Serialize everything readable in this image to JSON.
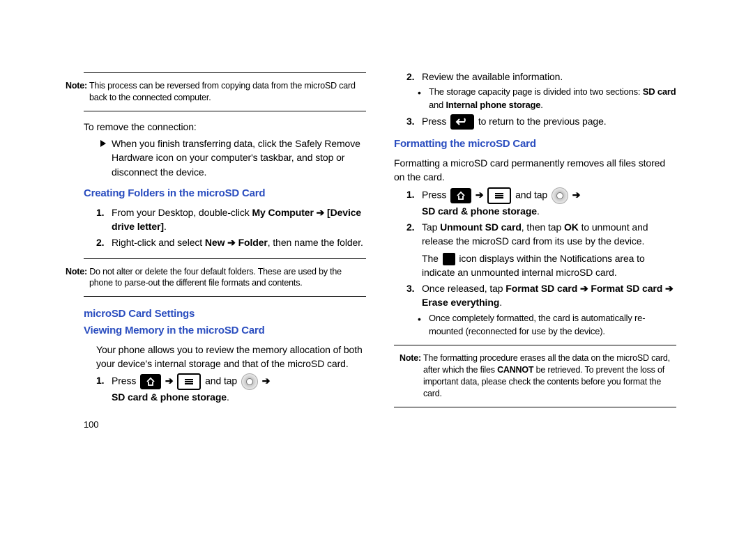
{
  "left": {
    "note1": {
      "label": "Note:",
      "text": " This process can be reversed from copying data from the microSD card back to the connected computer."
    },
    "removeIntro": "To remove the connection:",
    "removeBullet": "When you finish transferring data, click the Safely Remove Hardware icon on your computer's taskbar, and stop or disconnect the device.",
    "h1": "Creating Folders in the microSD Card",
    "step1_pre": "From your Desktop, double-click ",
    "step1_b1": "My Computer",
    "step1_arrow": " ➔ ",
    "step1_b2": "[Device drive letter]",
    "step1_post": ".",
    "step2_pre": "Right-click and select ",
    "step2_b1": "New",
    "step2_arrow": " ➔ ",
    "step2_b2": "Folder",
    "step2_post": ", then name the folder.",
    "note2": {
      "label": "Note:",
      "text": " Do not alter or delete the four default folders. These are used by the phone to parse-out the different file formats and contents."
    },
    "h2": "microSD Card Settings",
    "h3": "Viewing Memory in the microSD Card",
    "viewPara": "Your phone allows you to review the memory allocation of both your device's internal storage and that of the microSD card.",
    "vm_step1_press": "Press ",
    "vm_step1_andtap": " and tap ",
    "vm_step1_b": "SD card & phone storage",
    "vm_step1_post": ".",
    "pageNumber": "100"
  },
  "right": {
    "num2": "2.",
    "s2_text": "Review the available information.",
    "s2_bullet_pre": "The storage capacity page is divided into two sections: ",
    "s2_bullet_b1": "SD card",
    "s2_bullet_mid": " and ",
    "s2_bullet_b2": "Internal phone storage",
    "s2_bullet_post": ".",
    "num3": "3.",
    "s3_press": "Press ",
    "s3_post": " to return to the previous page.",
    "h1": "Formatting the microSD Card",
    "fmt_para": "Formatting a microSD card permanently removes all files stored on the card.",
    "f1_press": "Press ",
    "f1_andtap": " and tap ",
    "f1_b": "SD card & phone storage",
    "f1_post": ".",
    "f2_pre": "Tap ",
    "f2_b1": "Unmount SD card",
    "f2_mid": ", then tap ",
    "f2_b2": "OK",
    "f2_post": " to unmount and release the microSD card from its use by the device.",
    "f2b_pre": "The ",
    "f2b_post": " icon displays within the Notifications area to indicate an unmounted internal microSD card.",
    "f3_pre": "Once released, tap ",
    "f3_b1": "Format SD card",
    "f3_arrow1": " ➔ ",
    "f3_b2": "Format SD card",
    "f3_arrow2": " ➔ ",
    "f3_b3": "Erase everything",
    "f3_post": ".",
    "f3_bullet": "Once completely formatted, the card is automatically re-mounted (reconnected for use by the device).",
    "note3": {
      "label": "Note:",
      "pre": " The formatting procedure erases all the data on the microSD card, after which the files ",
      "b": "CANNOT",
      "post": " be retrieved. To prevent the loss of important data, please check the contents before you format the card."
    }
  },
  "ol": {
    "n1": "1.",
    "n2": "2.",
    "n3": "3."
  }
}
